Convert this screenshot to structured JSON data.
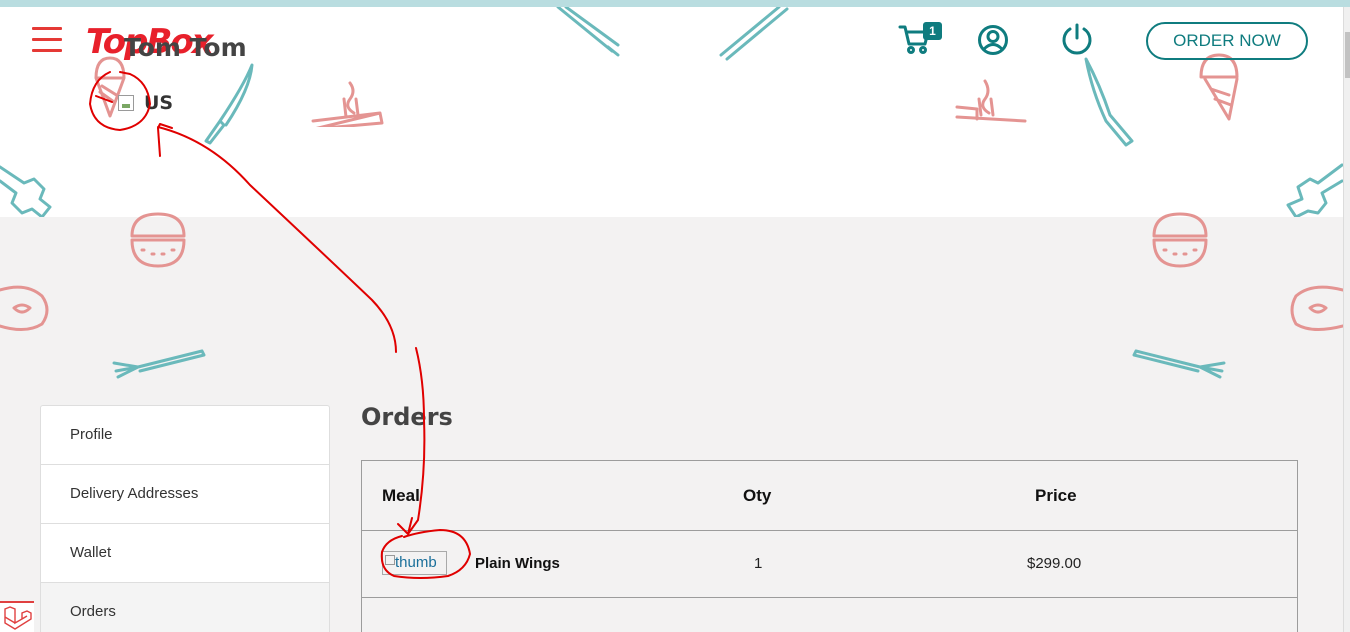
{
  "app": {
    "logo": "TopBox"
  },
  "header": {
    "user_name": "Tom Tom",
    "country_code": "US",
    "cart_count": "1",
    "order_button": "ORDER NOW"
  },
  "sidebar": {
    "items": [
      {
        "label": "Profile"
      },
      {
        "label": "Delivery Addresses"
      },
      {
        "label": "Wallet"
      },
      {
        "label": "Orders"
      }
    ]
  },
  "orders": {
    "title": "Orders",
    "columns": {
      "meal": "Meal",
      "qty": "Oty",
      "price": "Price"
    },
    "rows": [
      {
        "thumb_alt": "thumb",
        "meal": "Plain Wings",
        "qty": "1",
        "price": "$299.00"
      }
    ]
  },
  "colors": {
    "brand_red": "#e8202b",
    "teal": "#0f7c7f",
    "annotation_red": "#e00000"
  }
}
